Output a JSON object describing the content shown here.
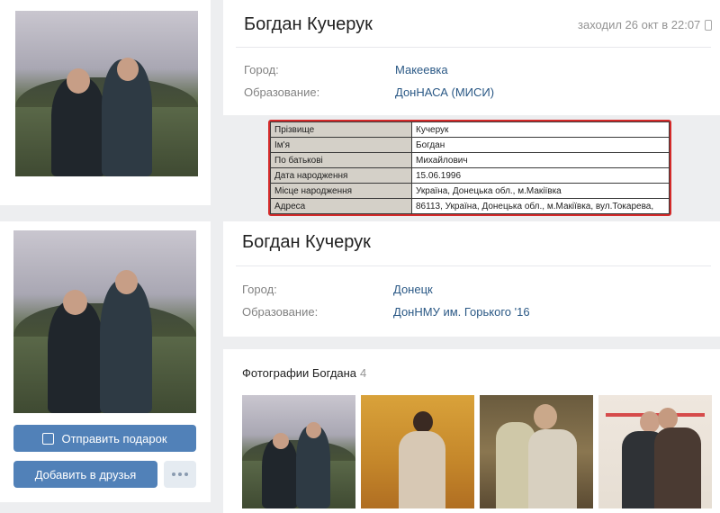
{
  "profile1": {
    "name": "Богдан Кучерук",
    "last_seen": "заходил 26 окт в 22:07",
    "city_label": "Город:",
    "city_value": "Макеевка",
    "edu_label": "Образование:",
    "edu_value": "ДонНАСА (МИСИ)"
  },
  "id_record": {
    "rows": [
      {
        "key": "Прізвище",
        "value": "Кучерук"
      },
      {
        "key": "Ім'я",
        "value": "Богдан"
      },
      {
        "key": "По батькові",
        "value": "Михайлович"
      },
      {
        "key": "Дата народження",
        "value": "15.06.1996"
      },
      {
        "key": "Місце народження",
        "value": "Україна, Донецька обл., м.Макіївка"
      },
      {
        "key": "Адреса",
        "value": "86113, Україна, Донецька обл., м.Макіївка, вул.Токарева,"
      }
    ]
  },
  "profile2": {
    "name": "Богдан Кучерук",
    "city_label": "Город:",
    "city_value": "Донецк",
    "edu_label": "Образование:",
    "edu_value": "ДонНМУ им. Горького '16",
    "gift_button": "Отправить подарок",
    "add_friend_button": "Добавить в друзья"
  },
  "photos": {
    "title": "Фотографии Богдана",
    "count": "4"
  },
  "icons": {
    "phone": "mobile-phone-icon",
    "gift": "gift-icon",
    "more": "more-dots-icon"
  },
  "colors": {
    "link": "#2a5885",
    "button": "#5181b8",
    "highlight_border": "#d42a2a",
    "background": "#edeef0"
  }
}
